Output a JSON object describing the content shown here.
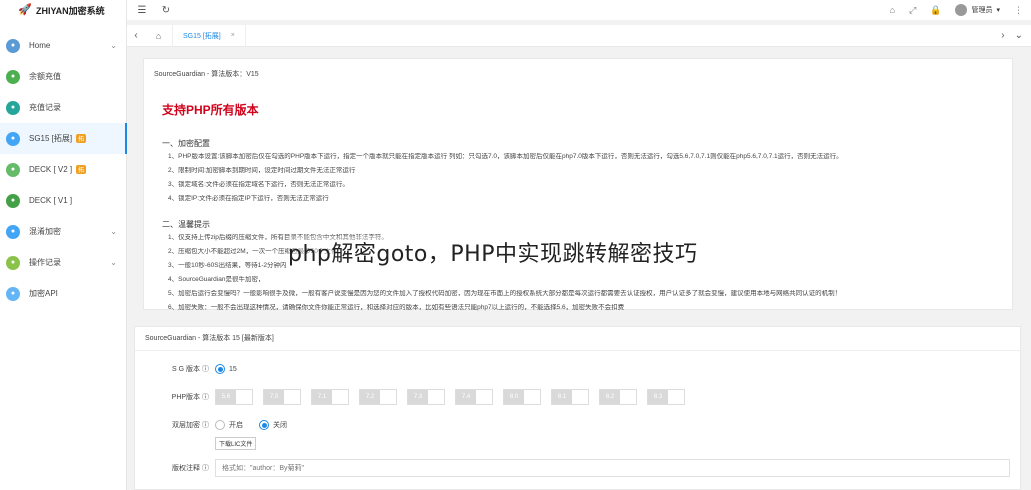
{
  "app": {
    "title": "ZHIYAN加密系统"
  },
  "sidebar": {
    "items": [
      {
        "label": "Home",
        "icon": "home-icon",
        "color": "#5b9bd5",
        "chev": true,
        "badge": ""
      },
      {
        "label": "余额充值",
        "icon": "wallet-icon",
        "color": "#4caf50",
        "chev": false,
        "badge": ""
      },
      {
        "label": "充值记录",
        "icon": "history-icon",
        "color": "#26a69a",
        "chev": false,
        "badge": ""
      },
      {
        "label": "SG15 [拓展]",
        "icon": "code-icon",
        "color": "#42a5f5",
        "chev": false,
        "badge": "拓"
      },
      {
        "label": "DECK [ V2 ]",
        "icon": "code-icon",
        "color": "#66bb6a",
        "chev": false,
        "badge": "拓"
      },
      {
        "label": "DECK [ V1 ]",
        "icon": "code-icon",
        "color": "#43a047",
        "chev": false,
        "badge": ""
      },
      {
        "label": "混淆加密",
        "icon": "shuffle-icon",
        "color": "#42a5f5",
        "chev": true,
        "badge": ""
      },
      {
        "label": "操作记录",
        "icon": "list-icon",
        "color": "#8bc34a",
        "chev": true,
        "badge": ""
      },
      {
        "label": "加密API",
        "icon": "api-icon",
        "color": "#64b5f6",
        "chev": false,
        "badge": ""
      }
    ]
  },
  "header": {
    "user": "管理员"
  },
  "tabs": {
    "active": "SG15 [拓展]"
  },
  "info": {
    "header": "SourceGuardian - 算法版本：V15",
    "title": "支持PHP所有版本",
    "section1": "一、加密配置",
    "s1": [
      "1、PHP版本设置:该脚本加密后仅在勾选的PHP版本下运行，指定一个版本就只能在指定版本运行 列如：只勾选7.0，该脚本加密后仅能在php7.0版本下运行，否则无法运行，勾选5.6,7.0,7.1则仅能在php5.6,7.0,7.1运行，否则无法运行。",
      "2、限制时间:加密脚本到期时间，设定时间过期文件无法正常运行",
      "3、锁定域名:文件必须在指定域名下运行，否则无法正常运行。",
      "4、锁定IP:文件必须在指定IP下运行，否则无法正常运行"
    ],
    "section2": "二、温馨提示",
    "s2": [
      "1、仅支持上传zip后缀的压缩文件，所有目录不能包含中文和其他非法字符。",
      "2、压缩包大小不能超过2M，一次一个压缩包最多50个文件",
      "3、一般10秒-60S出结果，等待1-2分钟内",
      "4、SourceGuardian是很牛加密，",
      "5、加密后运行会变慢吗？一般影响很手及微，一般有客户说变慢是因为您的文件加入了授权代码加密，因为现在市面上的授权系统大部分都是每次运行都需要去认证授权，用户认证多了就会变慢，建议使用本地与网络共同认证的机制！",
      "6、加密失败：一般不会出现这种情况，请确保你文件你能正常运行，和选择对应的版本，比如有些语法只能php7以上运行的，不能选择5.6，加密失败不会扣费"
    ]
  },
  "overlay_text": "php解密goto，PHP中实现跳转解密技巧",
  "form": {
    "header": "SourceGuardian - 算法版本 15 [最新版本]",
    "sg_label": "S G 版本 ⓘ",
    "sg_value": "15",
    "php_label": "PHP版本 ⓘ",
    "php_versions": [
      "5.6",
      "7.0",
      "7.1",
      "7.2",
      "7.3",
      "7.4",
      "8.0",
      "8.1",
      "8.2",
      "8.3"
    ],
    "double_label": "双层加密 ⓘ",
    "double_on": "开启",
    "double_off": "关闭",
    "download_btn": "下载LIC文件",
    "copyright_label": "版权注释 ⓘ",
    "copyright_placeholder": "格式如：\"author：By菊莉\""
  }
}
